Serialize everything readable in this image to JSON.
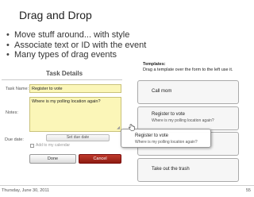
{
  "slide": {
    "title": "Drag and Drop",
    "bullets": [
      "Move stuff around... with style",
      "Associate text or ID with the event",
      "Many types of drag events"
    ],
    "footer_date": "Thursday, June 30, 2011",
    "page_number": "55"
  },
  "form": {
    "title": "Task Details",
    "task_name_label": "Task Name:",
    "task_name_value": "Register to vote",
    "notes_label": "Notes:",
    "notes_value": "Where is my polling location again?",
    "due_date_label": "Due date:",
    "set_due_date_label": "Set due date",
    "add_to_calendar_label": "Add to my calendar",
    "done_label": "Done",
    "cancel_label": "Cancel"
  },
  "templates": {
    "heading": "Templates:",
    "instructions": "Drag a template over the form to the left use it.",
    "items": [
      {
        "title": "Call mom",
        "desc": ""
      },
      {
        "title": "Register to vote",
        "desc": "Where is my polling location again?"
      },
      {
        "title": "",
        "desc": ""
      },
      {
        "title": "Take out the trash",
        "desc": ""
      }
    ],
    "dragging": {
      "title": "Register to vote",
      "desc": "Where is my polling location again?"
    }
  },
  "colors": {
    "input_bg": "#fbf6b8",
    "cancel_bg": "#b22d22"
  }
}
